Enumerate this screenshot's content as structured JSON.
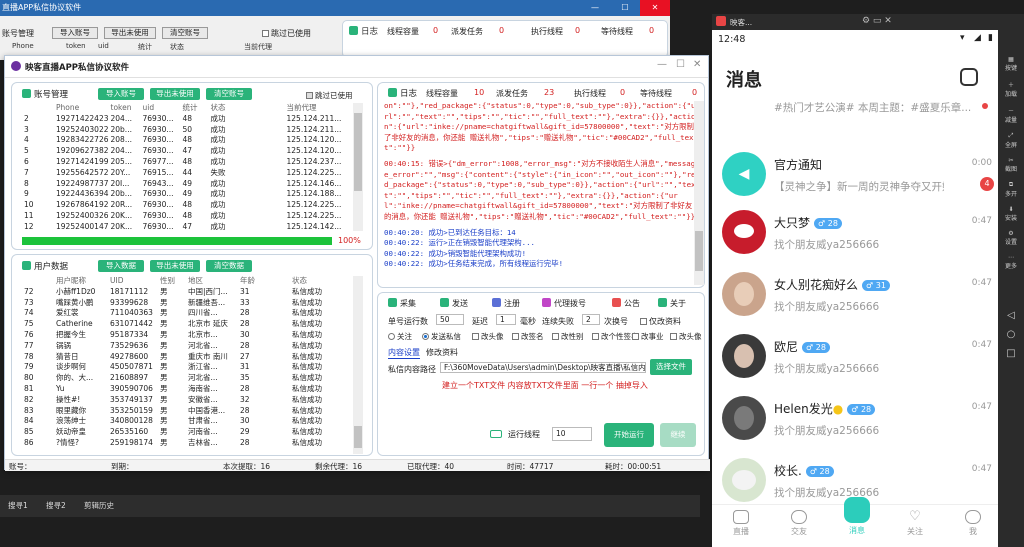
{
  "bg_window": {
    "title": "直播APP私信协议软件",
    "account_tab": "账号管理",
    "buttons": [
      "导入账号",
      "导出未使用",
      "清空账号"
    ],
    "skip_used": "跳过已使用",
    "cols": [
      "Phone",
      "token",
      "uid",
      "统计",
      "状态",
      "当前代理"
    ],
    "log_label": "日志",
    "stats": {
      "lbl1": "线程容量",
      "v1": "0",
      "lbl2": "派发任务",
      "v2": "0",
      "lbl3": "执行线程",
      "v3": "0",
      "lbl4": "等待线程",
      "v4": "0"
    }
  },
  "main": {
    "title": "映客直播APP私信协议软件",
    "account": {
      "title": "账号管理",
      "buttons": [
        "导入账号",
        "导出未使用",
        "清空账号"
      ],
      "skip_used": "跳过已使用",
      "cols": [
        "Phone",
        "token",
        "uid",
        "统计",
        "状态",
        "当前代理"
      ],
      "rows": [
        [
          "2",
          "19271422423",
          "204...",
          "76930...",
          "48",
          "成功",
          "125.124.211..."
        ],
        [
          "3",
          "19252403022",
          "20b...",
          "76930...",
          "50",
          "成功",
          "125.124.211..."
        ],
        [
          "4",
          "19283422726",
          "208...",
          "76930...",
          "48",
          "成功",
          "125.124.120..."
        ],
        [
          "5",
          "19209627382",
          "204...",
          "76930...",
          "47",
          "成功",
          "125.124.120..."
        ],
        [
          "6",
          "19271424199",
          "205...",
          "76977...",
          "48",
          "成功",
          "125.124.237..."
        ],
        [
          "7",
          "19255642572",
          "20Y...",
          "76915...",
          "44",
          "失败",
          "125.124.225..."
        ],
        [
          "8",
          "19224987737",
          "20I...",
          "76943...",
          "49",
          "成功",
          "125.124.146..."
        ],
        [
          "9",
          "19224436394",
          "20b...",
          "76930...",
          "49",
          "成功",
          "125.124.188..."
        ],
        [
          "10",
          "19267864192",
          "20R...",
          "76930...",
          "48",
          "成功",
          "125.124.225..."
        ],
        [
          "11",
          "19252400326",
          "20K...",
          "76930...",
          "48",
          "成功",
          "125.124.225..."
        ],
        [
          "12",
          "19252400147",
          "20K...",
          "76930...",
          "47",
          "成功",
          "125.124.142..."
        ]
      ],
      "progress_label": "100%",
      "progress": 1.0
    },
    "user": {
      "title": "用户数据",
      "buttons": [
        "导入数据",
        "导出未使用",
        "清空数据"
      ],
      "cols": [
        "用户昵称",
        "UID",
        "性别",
        "地区",
        "年龄",
        "状态"
      ],
      "rows": [
        [
          "72",
          "小赫ff1Dz0",
          "18171112",
          "男",
          "中国|西门...",
          "31",
          "私信成功"
        ],
        [
          "73",
          "嘴踩黄小鹏",
          "93399628",
          "男",
          "新疆维吾...",
          "33",
          "私信成功"
        ],
        [
          "74",
          "爱红裳",
          "711040363",
          "男",
          "四川省...",
          "28",
          "私信成功"
        ],
        [
          "75",
          "Catherine",
          "631071442",
          "男",
          "北京市 延庆",
          "28",
          "私信成功"
        ],
        [
          "76",
          "把握今生",
          "95187334",
          "男",
          "北京市...",
          "30",
          "私信成功"
        ],
        [
          "77",
          "锅锅",
          "73529636",
          "男",
          "河北省...",
          "28",
          "私信成功"
        ],
        [
          "78",
          "猜昔日",
          "49278600",
          "男",
          "重庆市 南川",
          "27",
          "私信成功"
        ],
        [
          "79",
          "谈步啊何",
          "450507871",
          "男",
          "浙江省...",
          "31",
          "私信成功"
        ],
        [
          "80",
          "你的、大...",
          "21608897",
          "男",
          "河北省...",
          "35",
          "私信成功"
        ],
        [
          "81",
          "Yu",
          "390590706",
          "男",
          "海南省...",
          "28",
          "私信成功"
        ],
        [
          "82",
          "操性#!",
          "353749137",
          "男",
          "安徽省...",
          "32",
          "私信成功"
        ],
        [
          "83",
          "眼里藏你",
          "353250159",
          "男",
          "中国香港...",
          "28",
          "私信成功"
        ],
        [
          "84",
          "浪荡绅士",
          "340800128",
          "男",
          "甘肃省...",
          "30",
          "私信成功"
        ],
        [
          "85",
          "妖动帝皇",
          "26535160",
          "男",
          "河南省...",
          "29",
          "私信成功"
        ],
        [
          "86",
          "?情怪?",
          "259198174",
          "男",
          "吉林省...",
          "28",
          "私信成功"
        ]
      ]
    },
    "log": {
      "label": "日志",
      "lbl1": "线程容量",
      "v1": "10",
      "lbl2": "派发任务",
      "v2": "23",
      "lbl3": "执行线程",
      "v3": "0",
      "lbl4": "等待线程",
      "v4": "0",
      "block1": "on\":\"\"},\"red_package\":{\"status\":0,\"type\":0,\"sub_type\":0}},\"action\":{\"url\":\"\",\"text\":\"\",\"tips\":\"\",\"tic\":\"\",\"full_text\":\"\"},\"extra\":{}},\"action\":{\"url\":\"inke://pname=chatgiftwall&gift_id=57800000\",\"text\":\"对方限制了非好友的消息，你还能 赠送礼物\",\"tips\":\"赠送礼物\",\"tic\":\"#00CAD2\",\"full_text\":\"\"}}",
      "block2": "00:40:15: 错误>{\"dm_error\":1008,\"error_msg\":\"对方不接收陌生人消息\",\"message_error\":\"\",\"msg\":{\"content\":{\"style\":{\"in_icon\":\"\",\"out_icon\":\"\"},\"red_package\":{\"status\":0,\"type\":0,\"sub_type\":0}},\"action\":{\"url\":\"\",\"text\":\"\",\"tips\":\"\",\"tic\":\"\",\"full_text\":\"\"},\"extra\":{}},\"action\":{\"url\":\"inke://pname=chatgiftwall&gift_id=57800000\",\"text\":\"对方限制了非好友的消息，你还能 赠送礼物\",\"tips\":\"赠送礼物\",\"tic\":\"#00CAD2\",\"full_text\":\"\"}}",
      "blue_lines": [
        "00:40:20: 成功>已到达任务目标：14",
        "00:40:22: 运行>正在销毁智能代理架构...",
        "00:40:22: 成功>销毁智能代理架构成功!",
        "00:40:22: 成功>任务结束完成，所有线程运行完毕!"
      ]
    },
    "tabs": [
      "采集",
      "发送",
      "注册",
      "代理拨号",
      "公告",
      "关于"
    ],
    "send": {
      "single_count_label": "单号运行数",
      "single_count": "50",
      "delay_label": "延迟",
      "delay": "1",
      "ms_label": "毫秒",
      "fail_label": "连续失败",
      "fail": "2",
      "switch_label": "次换号",
      "modify_label": "仅改资料",
      "opt_follow": "关注",
      "opt_send": "发送私信",
      "opt_avatar": "改头像",
      "opt_name": "改签名",
      "opt_gender": "改性别",
      "opt_sig": "改个性签名",
      "opt_job": "改事业",
      "opt_bg": "改头像",
      "content_settings": "内容设置",
      "edit_profile": "修改资料",
      "path_label": "私信内容路径",
      "path": "F:\\360MoveData\\Users\\admin\\Desktop\\映客直播\\私信内",
      "choose_file": "选择文件",
      "hint": "建立一个TXT文件 内容放TXT文件里面 一行一个 抽掉导入",
      "threads_label": "运行线程",
      "threads": "10",
      "start": "开始运行",
      "continue": "继续"
    },
    "status": {
      "account": "账号：",
      "expire": "到期：",
      "this_get": "本次提取：16",
      "remain": "剩余代理：16",
      "extracted": "已取代理：40",
      "time": "时间：47717",
      "elapsed": "耗时：00:00:51"
    }
  },
  "taskbar": {
    "items": [
      "搜寻1",
      "搜寻2",
      "剪辑历史"
    ]
  },
  "phone": {
    "topbar_title": "映客...",
    "time": "12:48",
    "header": "消息",
    "banner": "#热门才艺公演# 本周主题：#盛夏乐章...",
    "official": {
      "name": "官方通知",
      "time": "0:00",
      "msg": "【灵神之争】新一周的灵神争夺又开始...",
      "badge": "4"
    },
    "chats": [
      {
        "name": "大只梦",
        "age": "28",
        "time": "0:47",
        "msg": "找个朋友威ya256666"
      },
      {
        "name": "女人别花痴好么",
        "age": "31",
        "time": "0:47",
        "msg": "找个朋友威ya256666"
      },
      {
        "name": "欧尼",
        "age": "28",
        "time": "0:47",
        "msg": "找个朋友威ya256666"
      },
      {
        "name": "Helen发光",
        "age": "28",
        "time": "0:47",
        "msg": "找个朋友威ya256666"
      },
      {
        "name": "校长.",
        "age": "28",
        "time": "0:47",
        "msg": "找个朋友威ya256666"
      }
    ],
    "nav": [
      "直播",
      "交友",
      "消息",
      "关注",
      "我"
    ],
    "side_tools": [
      "按键",
      "加载",
      "减量",
      "全屏",
      "截图",
      "多开",
      "安装",
      "设置",
      "更多"
    ]
  },
  "colors": {
    "accent_green": "#2ab37a",
    "log_red": "#d32020",
    "log_blue": "#1a3ec8",
    "phone_age": "#4fa8f3"
  }
}
